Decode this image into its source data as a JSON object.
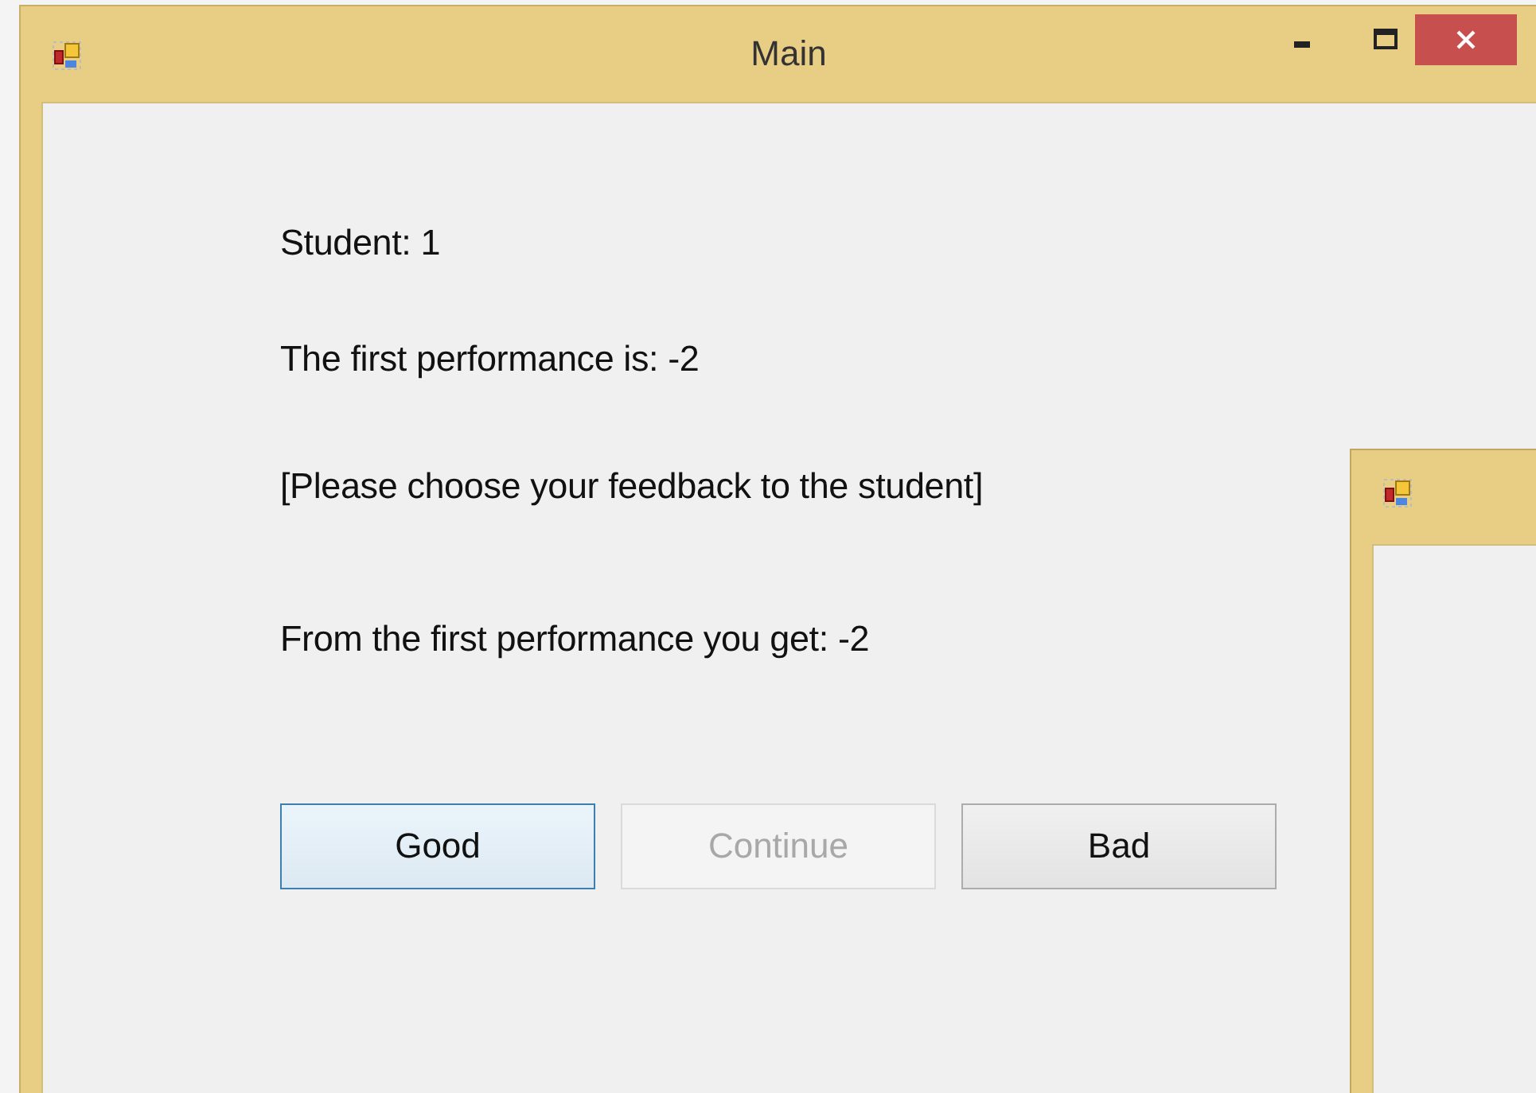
{
  "window": {
    "title": "Main"
  },
  "labels": [
    "Student: 1",
    "The first performance is: -2",
    "[Please choose your feedback to the student]",
    "From the first performance you get: -2"
  ],
  "buttons": [
    {
      "label": "Good",
      "focused": true,
      "disabled": false
    },
    {
      "label": "Continue",
      "focused": false,
      "disabled": true
    },
    {
      "label": "Bad",
      "focused": false,
      "disabled": false
    }
  ]
}
